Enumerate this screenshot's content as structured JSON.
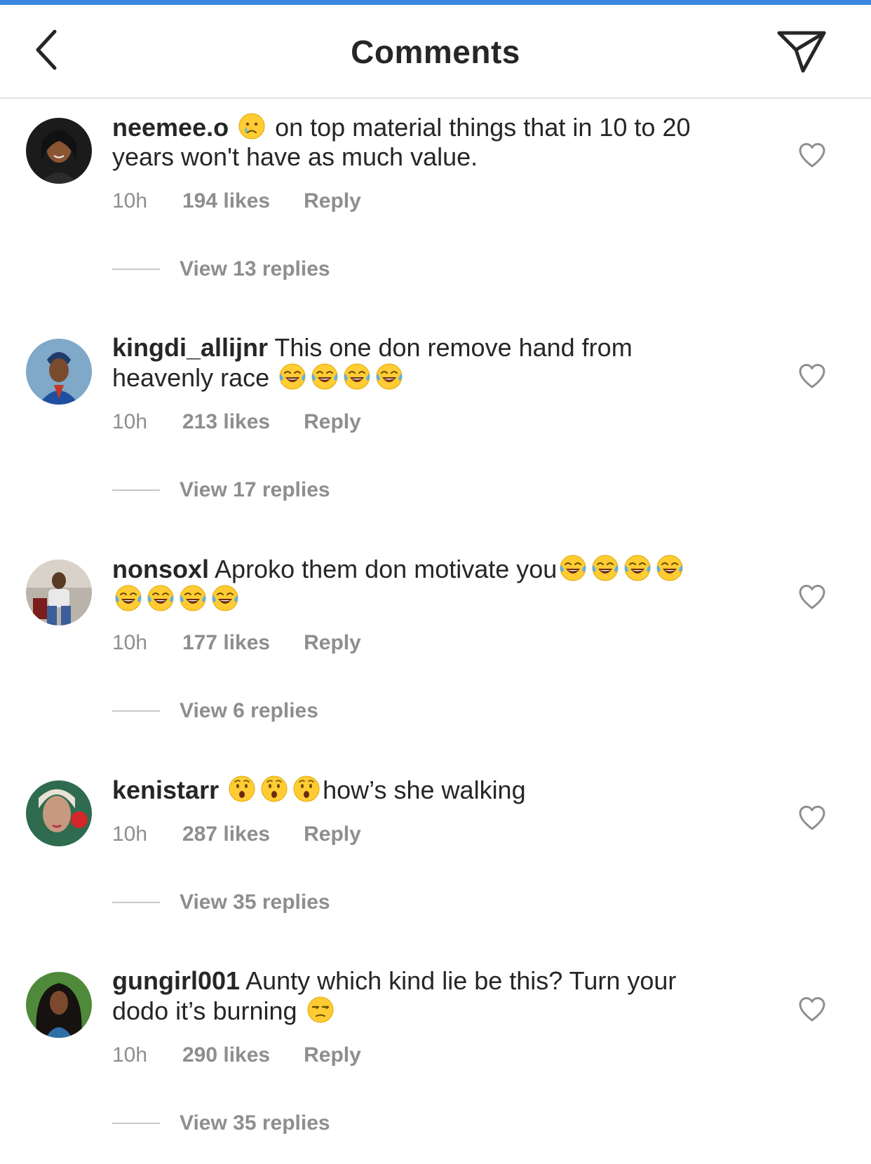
{
  "header": {
    "title": "Comments"
  },
  "colors": {
    "accent_bar": "#3a86e0",
    "text": "#262626",
    "muted": "#8e8e8e"
  },
  "comments": [
    {
      "username": "neemee.o",
      "text_line1": "on top material things that in 10 to 20",
      "text_line2": "years won't have as much value.",
      "emoji_icons": [
        "crying-face-icon"
      ],
      "time": "10h",
      "likes": "194 likes",
      "reply": "Reply",
      "view_replies": "View 13 replies"
    },
    {
      "username": "kingdi_allijnr",
      "text_line1": "This one don remove hand from",
      "text_line2": "heavenly race",
      "emoji_icons": [
        "tears-of-joy-icon",
        "tears-of-joy-icon",
        "tears-of-joy-icon",
        "tears-of-joy-icon"
      ],
      "time": "10h",
      "likes": "213 likes",
      "reply": "Reply",
      "view_replies": "View 17 replies"
    },
    {
      "username": "nonsoxl",
      "text_line1": "Aproko them don motivate you",
      "text_line2": "",
      "emoji_icons": [
        "tears-of-joy-icon",
        "tears-of-joy-icon",
        "tears-of-joy-icon",
        "tears-of-joy-icon",
        "tears-of-joy-icon",
        "tears-of-joy-icon",
        "tears-of-joy-icon",
        "tears-of-joy-icon"
      ],
      "time": "10h",
      "likes": "177 likes",
      "reply": "Reply",
      "view_replies": "View 6 replies"
    },
    {
      "username": "kenistarr",
      "text_line1": "how’s she walking",
      "text_line2": "",
      "emoji_icons": [
        "surprised-face-icon",
        "surprised-face-icon",
        "surprised-face-icon"
      ],
      "time": "10h",
      "likes": "287 likes",
      "reply": "Reply",
      "view_replies": "View 35 replies"
    },
    {
      "username": "gungirl001",
      "text_line1": "Aunty which kind lie be this? Turn your",
      "text_line2": "dodo it’s burning",
      "emoji_icons": [
        "unamused-face-icon"
      ],
      "time": "10h",
      "likes": "290 likes",
      "reply": "Reply",
      "view_replies": "View 35 replies"
    }
  ]
}
